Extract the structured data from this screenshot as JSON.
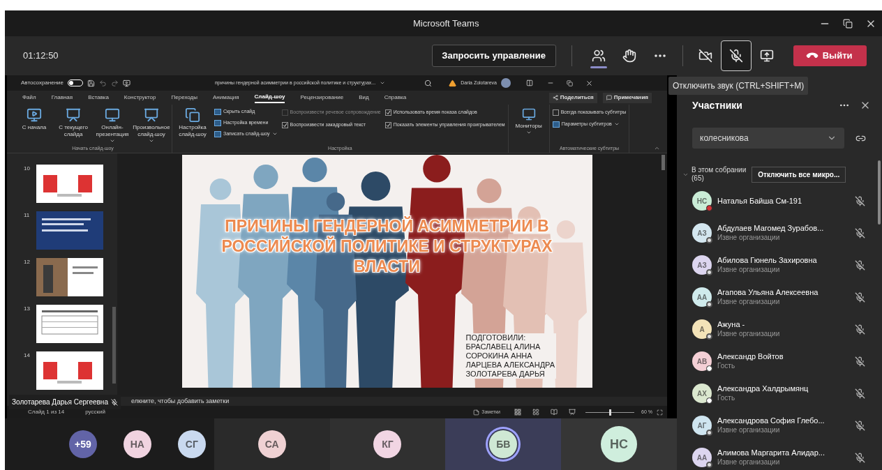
{
  "window": {
    "title": "Microsoft Teams"
  },
  "meeting_bar": {
    "timer": "01:12:50",
    "request_control": "Запросить управление",
    "controls": [
      {
        "kind": "people",
        "selected": true
      },
      {
        "kind": "hand"
      },
      {
        "kind": "more"
      },
      {
        "kind": "camera",
        "on": false
      },
      {
        "kind": "mic",
        "on": false,
        "hovered": true
      },
      {
        "kind": "share"
      }
    ],
    "leave": "Выйти"
  },
  "tooltip": "Отключить звук (CTRL+SHIFT+M)",
  "powerpoint": {
    "autosave_label": "Автосохранение",
    "autosave_on": false,
    "document_title": "причины гендерной асимметрии в российской политике и структурах...",
    "user_name": "Daria Zolotareva",
    "share_button": "Поделиться",
    "comments_button": "Примечания",
    "tabs": [
      {
        "label": "Файл",
        "selected": false
      },
      {
        "label": "Главная",
        "selected": false
      },
      {
        "label": "Вставка",
        "selected": false
      },
      {
        "label": "Конструктор",
        "selected": false
      },
      {
        "label": "Переходы",
        "selected": false
      },
      {
        "label": "Анимация",
        "selected": false
      },
      {
        "label": "Слайд-шоу",
        "selected": true
      },
      {
        "label": "Рецензирование",
        "selected": false
      },
      {
        "label": "Вид",
        "selected": false
      },
      {
        "label": "Справка",
        "selected": false
      }
    ],
    "ribbon": [
      {
        "label": "Начать слайд-шоу",
        "columns": [
          [
            {
              "kind": "large",
              "label": "С начала"
            }
          ],
          [
            {
              "kind": "large",
              "label": "С текущего слайда"
            }
          ],
          [
            {
              "kind": "large",
              "label": "Онлайн-презентация",
              "menu": true
            }
          ],
          [
            {
              "kind": "large",
              "label": "Произвольное слайд-шоу",
              "menu": true
            }
          ]
        ]
      },
      {
        "label": "Настройка",
        "columns": [
          [
            {
              "kind": "large",
              "label": "Настройка слайд-шоу"
            }
          ],
          [
            {
              "kind": "small",
              "label": "Скрыть слайд"
            },
            {
              "kind": "small",
              "label": "Настройка времени"
            },
            {
              "kind": "small",
              "label": "Записать слайд-шоу",
              "menu": true
            }
          ],
          [
            {
              "kind": "check",
              "label": "Воспроизвести речевое сопровождение",
              "checked": false,
              "disabled": true
            },
            {
              "kind": "check",
              "label": "Воспроизвести закадровый текст",
              "checked": true,
              "disabled": false
            }
          ],
          [
            {
              "kind": "check",
              "label": "Использовать время показа слайдов",
              "checked": true,
              "disabled": false
            },
            {
              "kind": "check",
              "label": "Показать элементы управления проигрывателем",
              "checked": true,
              "disabled": false
            }
          ]
        ]
      },
      {
        "columns": [
          [
            {
              "kind": "large",
              "label": "Мониторы",
              "menu": true
            }
          ]
        ]
      },
      {
        "label": "Автоматические субтитры",
        "columns": [
          [
            {
              "kind": "check",
              "label": "Всегда показывать субтитры",
              "checked": false,
              "disabled": false
            },
            {
              "kind": "small",
              "label": "Параметры субтитров",
              "menu": true
            }
          ]
        ]
      }
    ],
    "thumbnails": [
      {
        "number": "10",
        "kind": "figures"
      },
      {
        "number": "11",
        "kind": "text"
      },
      {
        "number": "12"
      },
      {
        "number": "13",
        "kind": "table"
      },
      {
        "number": "14",
        "kind": "figures"
      }
    ],
    "slide": {
      "title": "ПРИЧИНЫ ГЕНДЕРНОЙ АСИММЕТРИИ В РОССИЙСКОЙ ПОЛИТИКЕ И СТРУКТУРАХ ВЛАСТИ",
      "credits_heading": "ПОДГОТОВИЛИ:",
      "credits": [
        "БРАСЛАВЕЦ АЛИНА",
        "СОРОКИНА АННА",
        "ЛАРЦЕВА АЛЕКСАНДРА",
        "ЗОЛОТАРЕВА ДАРЬЯ"
      ]
    },
    "notes_placeholder": "елкните, чтобы добавить заметки",
    "status": {
      "slide_counter": "Слайд 1 из 14",
      "language": "русский",
      "notes_button": "Заметки",
      "zoom": "60 %",
      "level": 0.5
    }
  },
  "presenter": "Золотарева Дарья Сергеевна",
  "video_tiles": [
    {
      "avatars": [
        {
          "initials": "+59",
          "color": "#6264a7",
          "speaking": false
        },
        {
          "initials": "НА",
          "color": "#f0d3e0",
          "speaking": false
        },
        {
          "initials": "СГ",
          "color": "#c9d9ef",
          "speaking": false
        }
      ]
    },
    {
      "avatars": [
        {
          "initials": "СА",
          "color": "#efd1d3",
          "speaking": false
        }
      ]
    },
    {
      "avatars": [
        {
          "initials": "КГ",
          "color": "#f1d5e3",
          "speaking": false
        }
      ]
    },
    {
      "avatars": [
        {
          "initials": "БВ",
          "color": "#cfe8d4",
          "speaking": true
        }
      ]
    },
    {
      "avatars": [
        {
          "initials": "НС",
          "color": "#cfeedd",
          "speaking": false
        }
      ]
    }
  ],
  "participants": {
    "title": "Участники",
    "search_value": "колесникова",
    "section_label": "В этом собрании",
    "count": "(65)",
    "mute_all": "Отключить все микро...",
    "people": [
      {
        "initials": "НС",
        "name": "Наталья Байша См-191",
        "color": "#c9ecd6",
        "kind": "busy",
        "muted": true
      },
      {
        "initials": "АЗ",
        "name": "Абдулаев Магомед Зурабов...",
        "subtitle": "Извне организации",
        "color": "#d3e6ef",
        "kind": "unknown",
        "muted": true
      },
      {
        "initials": "АЗ",
        "name": "Абилова Гюнель Захировна",
        "subtitle": "Извне организации",
        "color": "#dcd5ef",
        "kind": "unknown",
        "muted": true
      },
      {
        "initials": "АА",
        "name": "Агапова Ульяна Алексеевна",
        "subtitle": "Извне организации",
        "color": "#cfeaec",
        "kind": "unknown",
        "muted": true
      },
      {
        "initials": "А",
        "name": "Ажуна -",
        "subtitle": "Извне организации",
        "color": "#f3e3b8",
        "kind": "unknown",
        "muted": true
      },
      {
        "initials": "АВ",
        "name": "Александр Войтов",
        "subtitle": "Гость",
        "color": "#f4cfd5",
        "kind": "offline",
        "muted": true
      },
      {
        "initials": "АХ",
        "name": "Александра Халдрымянц",
        "subtitle": "Гость",
        "color": "#dbe8cf",
        "kind": "offline",
        "muted": true
      },
      {
        "initials": "АГ",
        "name": "Александрова София Глебо...",
        "subtitle": "Извне организации",
        "color": "#cfe5f0",
        "kind": "unknown",
        "muted": true
      },
      {
        "initials": "АА",
        "name": "Алимова Маргарита Алидар...",
        "subtitle": "Извне организации",
        "color": "#dcd5ef",
        "kind": "unknown",
        "muted": true
      }
    ]
  }
}
